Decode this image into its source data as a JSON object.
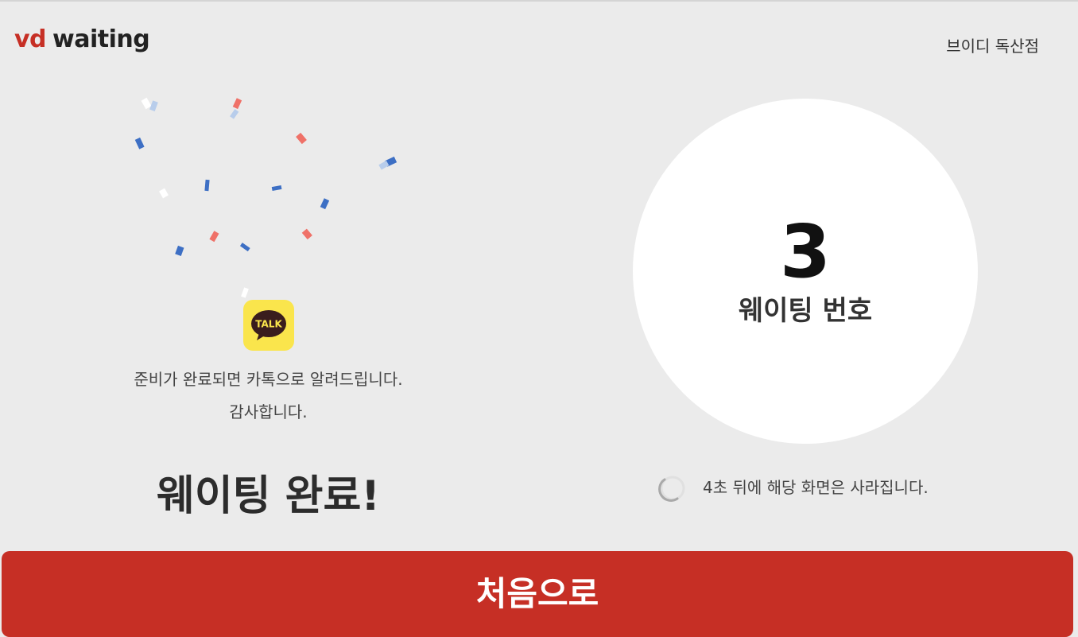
{
  "header": {
    "logo_vd": "vd",
    "logo_waiting": "waiting",
    "store_name": "브이디 독산점"
  },
  "left": {
    "kakao_icon_label": "TALK",
    "notice_line1": "준비가 완료되면 카톡으로 알려드립니다.",
    "notice_line2": "감사합니다.",
    "complete_title": "웨이팅 완료!"
  },
  "right": {
    "waiting_number": "3",
    "waiting_label": "웨이팅 번호",
    "countdown_text": "4초 뒤에 해당 화면은 사라집니다."
  },
  "footer": {
    "home_button_label": "처음으로"
  },
  "colors": {
    "brand_red": "#c62f25",
    "background": "#ebebeb",
    "kakao_yellow": "#fae54c",
    "confetti_blue": "#3d6fc4",
    "confetti_light_blue": "#b8cdeb",
    "confetti_red": "#ef7168",
    "confetti_white": "#ffffff"
  },
  "icons": {
    "logo": "vd-waiting-logo",
    "kakao": "kakaotalk-icon",
    "spinner": "loading-spinner-icon",
    "confetti": "confetti-decoration"
  }
}
